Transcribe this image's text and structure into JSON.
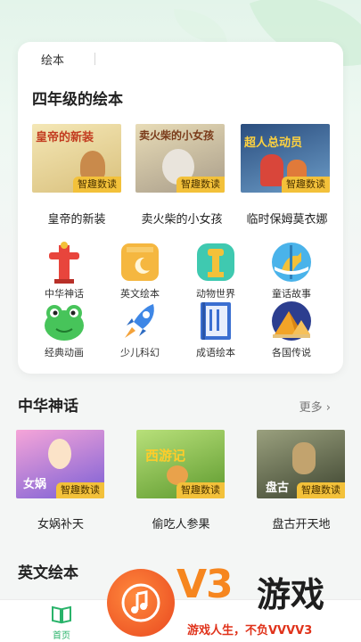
{
  "tab": {
    "label": "绘本"
  },
  "grade_section": {
    "title": "四年级的绘本",
    "books": [
      {
        "title": "皇帝的新装",
        "cover_text": "皇帝的新装",
        "badge": "智趣数读",
        "color": "#e9d9a0"
      },
      {
        "title": "卖火柴的小女孩",
        "cover_text": "卖火柴的小女孩",
        "badge": "智趣数读",
        "color": "#cfc2a2"
      },
      {
        "title": "临时保姆莫衣娜",
        "cover_text": "超人总动员",
        "badge": "智趣数读",
        "color": "#3e6fa8"
      }
    ]
  },
  "categories": [
    {
      "label": "中华神话",
      "icon": "pillar-icon",
      "color": "#e8453c"
    },
    {
      "label": "英文绘本",
      "icon": "book-moon-icon",
      "color": "#f5b740"
    },
    {
      "label": "动物世界",
      "icon": "giraffe-icon",
      "color": "#3fc9b0"
    },
    {
      "label": "童话故事",
      "icon": "carousel-horse-icon",
      "color": "#4ab3ea"
    },
    {
      "label": "经典动画",
      "icon": "frog-icon",
      "color": "#47c45a"
    },
    {
      "label": "少儿科幻",
      "icon": "rocket-icon",
      "color": "#3e87e6"
    },
    {
      "label": "成语绘本",
      "icon": "scroll-book-icon",
      "color": "#3b6fd1"
    },
    {
      "label": "各国传说",
      "icon": "pyramid-icon",
      "color": "#f2a428"
    }
  ],
  "myth_section": {
    "title": "中华神话",
    "more": "更多",
    "books": [
      {
        "title": "女娲补天",
        "cover_text": "女娲",
        "badge": "智趣数读",
        "color": "#b45bd0"
      },
      {
        "title": "偷吃人参果",
        "cover_text": "西游记",
        "badge": "智趣数读",
        "color": "#8fbf3a"
      },
      {
        "title": "盘古开天地",
        "cover_text": "盘古",
        "badge": "智趣数读",
        "color": "#5d6a4a"
      }
    ]
  },
  "english_section": {
    "title": "英文绘本"
  },
  "bottom_nav": {
    "home": "首页"
  },
  "watermark": {
    "brand": "V3",
    "game": "游戏",
    "slogan": "游戏人生，不负VVVV3"
  }
}
